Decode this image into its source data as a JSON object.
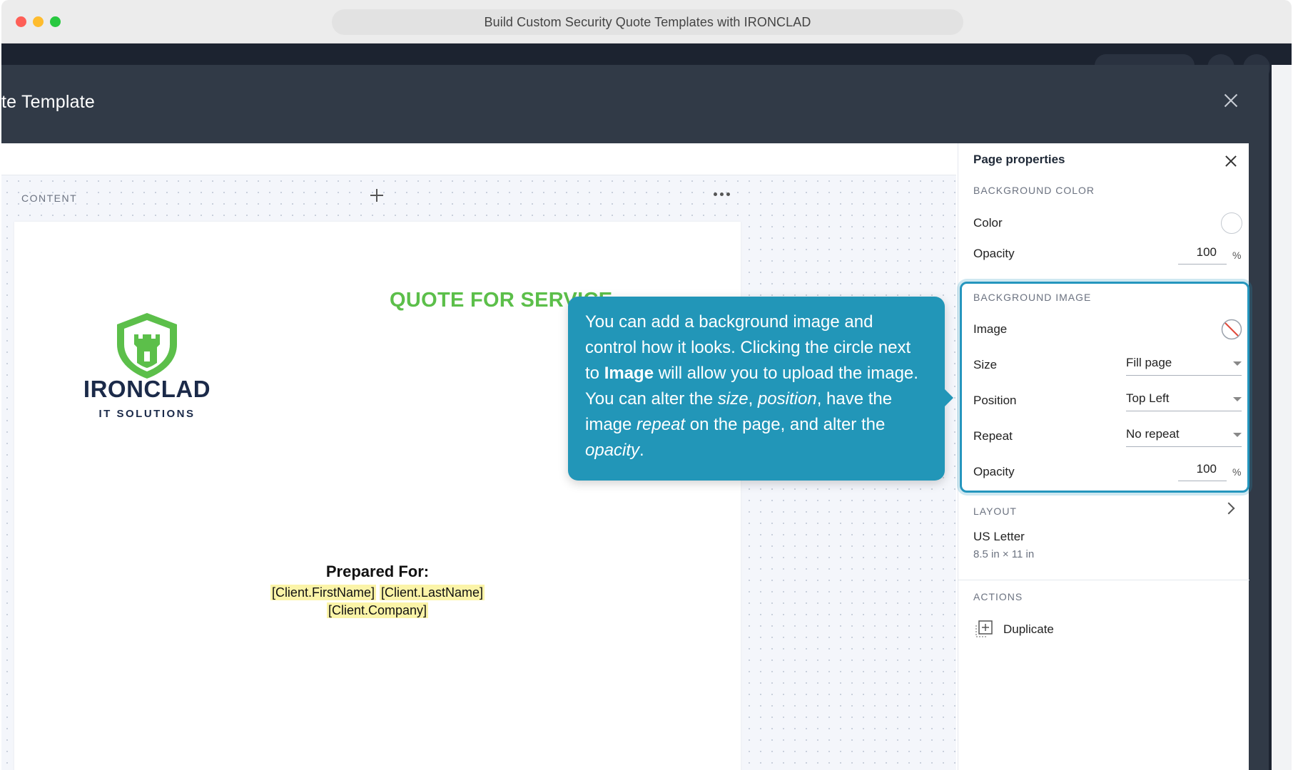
{
  "window": {
    "title": "Build Custom Security Quote Templates with IRONCLAD"
  },
  "modal": {
    "title": "te Template"
  },
  "canvas": {
    "section_label": "CONTENT"
  },
  "page": {
    "quote_title": "QUOTE FOR SERVICE",
    "logo": {
      "brand": "IRONCLAD",
      "sub": "IT SOLUTIONS",
      "color": "#5cbf4a",
      "text_color": "#1b2a49"
    },
    "prepared_for": {
      "heading": "Prepared For:",
      "first_name_tag": "[Client.FirstName]",
      "last_name_tag": "[Client.LastName]",
      "company_tag": "[Client.Company]"
    }
  },
  "tooltip": {
    "p1": "You can add a background image and control how it looks. Clicking the circle next to ",
    "bold1": "Image",
    "p2": " will allow you to upload the image. You can alter the ",
    "i_size": "size",
    "p3": ", ",
    "i_position": "position",
    "p4": ", have the image ",
    "i_repeat": "repeat",
    "p5": " on the page, and alter the ",
    "i_opacity": "opacity",
    "p6": ".",
    "color": "#2296b8"
  },
  "panel": {
    "title": "Page properties",
    "background_color": {
      "section": "BACKGROUND COLOR",
      "color_label": "Color",
      "opacity_label": "Opacity",
      "opacity_value": "100",
      "unit": "%"
    },
    "background_image": {
      "section": "BACKGROUND IMAGE",
      "image_label": "Image",
      "size_label": "Size",
      "size_value": "Fill page",
      "position_label": "Position",
      "position_value": "Top Left",
      "repeat_label": "Repeat",
      "repeat_value": "No repeat",
      "opacity_label": "Opacity",
      "opacity_value": "100",
      "unit": "%"
    },
    "layout": {
      "section": "LAYOUT",
      "page_size_name": "US Letter",
      "page_size_dims": "8.5 in × 11 in"
    },
    "actions": {
      "section": "ACTIONS",
      "duplicate_label": "Duplicate"
    }
  }
}
